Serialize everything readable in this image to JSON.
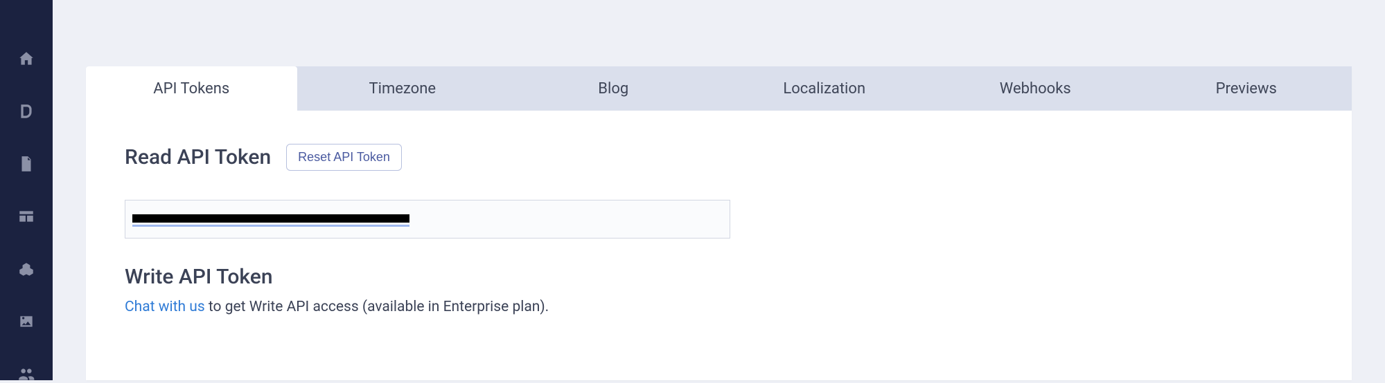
{
  "sidebar": {
    "items": [
      {
        "name": "home-icon"
      },
      {
        "name": "blog-icon"
      },
      {
        "name": "document-icon"
      },
      {
        "name": "grid-icon"
      },
      {
        "name": "addon-icon"
      },
      {
        "name": "image-icon"
      },
      {
        "name": "users-icon"
      }
    ]
  },
  "tabs": [
    {
      "label": "API Tokens",
      "active": true
    },
    {
      "label": "Timezone",
      "active": false
    },
    {
      "label": "Blog",
      "active": false
    },
    {
      "label": "Localization",
      "active": false
    },
    {
      "label": "Webhooks",
      "active": false
    },
    {
      "label": "Previews",
      "active": false
    }
  ],
  "readSection": {
    "heading": "Read API Token",
    "resetLabel": "Reset API Token",
    "tokenValue": "████████████████████████████████████████"
  },
  "writeSection": {
    "heading": "Write API Token",
    "chatLink": "Chat with us",
    "descSuffix": " to get Write API access (available in Enterprise plan)."
  }
}
